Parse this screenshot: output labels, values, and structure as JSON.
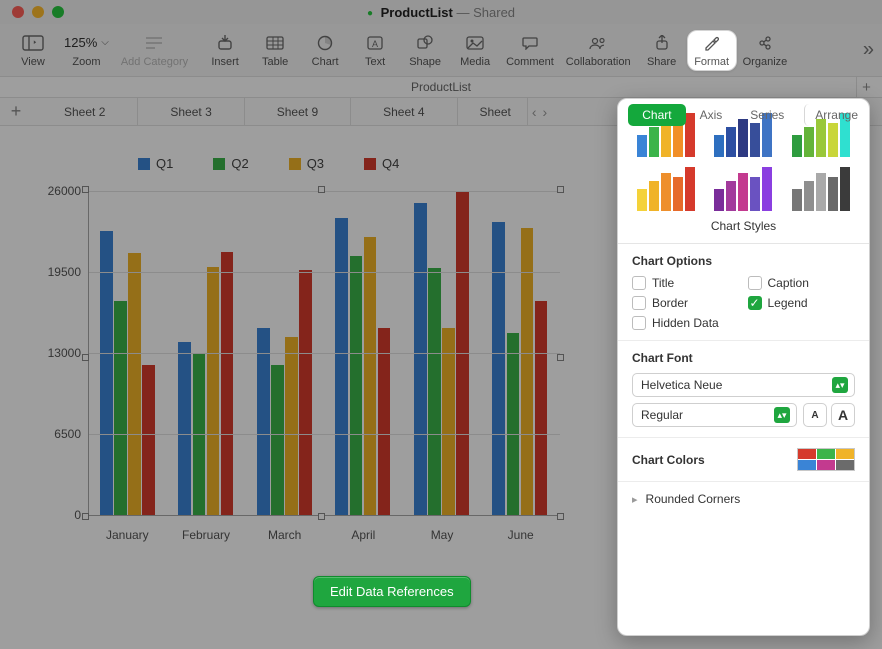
{
  "title": {
    "doc": "ProductList",
    "status": "Shared",
    "docbar": "ProductList"
  },
  "toolbar": {
    "view": "View",
    "zoom_label": "Zoom",
    "zoom_value": "125%",
    "add_category": "Add Category",
    "insert": "Insert",
    "table": "Table",
    "chart": "Chart",
    "text": "Text",
    "shape": "Shape",
    "media": "Media",
    "comment": "Comment",
    "collaboration": "Collaboration",
    "share": "Share",
    "format": "Format",
    "organize": "Organize"
  },
  "sheets": [
    "Sheet 2",
    "Sheet 3",
    "Sheet 9",
    "Sheet 4",
    "Sheet"
  ],
  "chart_legend": [
    "Q1",
    "Q2",
    "Q3",
    "Q4"
  ],
  "y_ticks": [
    "0",
    "6500",
    "13000",
    "19500",
    "26000"
  ],
  "x_labels": [
    "January",
    "February",
    "March",
    "April",
    "May",
    "June"
  ],
  "edit_refs": "Edit Data References",
  "inspector": {
    "tabs": {
      "chart": "Chart",
      "axis": "Axis",
      "series": "Series",
      "arrange": "Arrange"
    },
    "styles_label": "Chart Styles",
    "options_header": "Chart Options",
    "options": {
      "title": "Title",
      "caption": "Caption",
      "border": "Border",
      "legend": "Legend",
      "hidden": "Hidden Data"
    },
    "options_checked": {
      "title": false,
      "caption": false,
      "border": false,
      "legend": true,
      "hidden": false
    },
    "font_header": "Chart Font",
    "font_family": "Helvetica Neue",
    "font_style": "Regular",
    "colors_header": "Chart Colors",
    "rounded": "Rounded Corners"
  },
  "colors": {
    "q1": "#3a84d6",
    "q2": "#3bb44a",
    "q3": "#f0b328",
    "q4": "#d53a2c"
  },
  "chart_data": {
    "type": "bar",
    "title": "",
    "xlabel": "",
    "ylabel": "",
    "ylim": [
      0,
      26000
    ],
    "categories": [
      "January",
      "February",
      "March",
      "April",
      "May",
      "June"
    ],
    "series": [
      {
        "name": "Q1",
        "color": "#3a84d6",
        "values": [
          22800,
          13900,
          15000,
          23800,
          25000,
          23500
        ]
      },
      {
        "name": "Q2",
        "color": "#3bb44a",
        "values": [
          17200,
          13000,
          12000,
          20800,
          19800,
          14600
        ]
      },
      {
        "name": "Q3",
        "color": "#f0b328",
        "values": [
          21000,
          19900,
          14300,
          22300,
          15000,
          23000
        ]
      },
      {
        "name": "Q4",
        "color": "#d53a2c",
        "values": [
          12000,
          21100,
          19700,
          15000,
          26000,
          17200
        ]
      }
    ]
  },
  "style_thumbs": [
    [
      "#3a84d6",
      "#3bb44a",
      "#f0b328",
      "#f18f27",
      "#d53a2c"
    ],
    [
      "#2e6fbf",
      "#2d4fa2",
      "#2e3a82",
      "#374e9a",
      "#3f74c4"
    ],
    [
      "#2e9c3f",
      "#64b43a",
      "#9ac83a",
      "#c9d63a",
      "#2fe0d0"
    ],
    [
      "#f4d23a",
      "#f0b328",
      "#ee8f2c",
      "#e66a2a",
      "#d53a2c"
    ],
    [
      "#7a2d9a",
      "#a23a9c",
      "#c33a8f",
      "#6a52c1",
      "#8a3fe0"
    ],
    [
      "#777777",
      "#8f8f8f",
      "#a9a9a9",
      "#6a6a6a",
      "#3b3b3b"
    ]
  ],
  "palette_colors": [
    "#d53a2c",
    "#3bb44a",
    "#f0b328",
    "#3a84d6",
    "#c33a8f",
    "#6b6b6b"
  ]
}
